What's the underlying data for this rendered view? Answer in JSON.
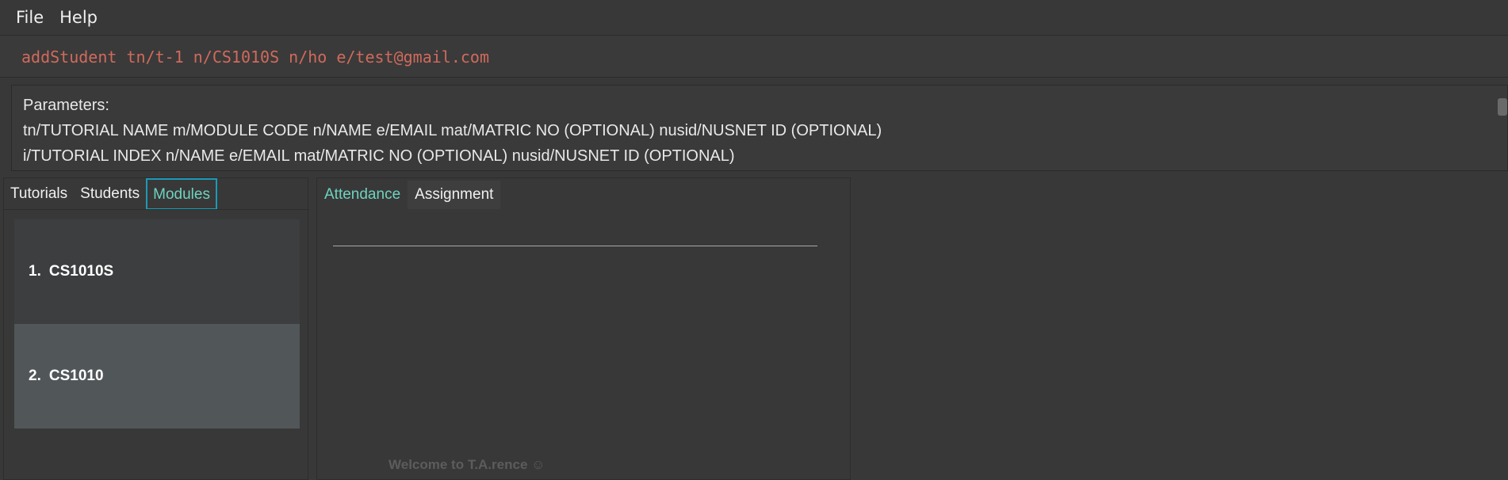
{
  "menu": {
    "items": [
      "File",
      "Help"
    ]
  },
  "command": {
    "value": "addStudent tn/t-1 n/CS1010S n/ho e/test@gmail.com"
  },
  "result": {
    "lines": [
      "Parameters:",
      "tn/TUTORIAL NAME m/MODULE CODE n/NAME e/EMAIL mat/MATRIC NO (OPTIONAL) nusid/NUSNET ID (OPTIONAL)",
      "i/TUTORIAL INDEX n/NAME e/EMAIL mat/MATRIC NO (OPTIONAL) nusid/NUSNET ID (OPTIONAL)"
    ]
  },
  "left_tabs": {
    "items": [
      "Tutorials",
      "Students",
      "Modules"
    ],
    "active": "Modules"
  },
  "modules": [
    {
      "index": "1.",
      "code": "CS1010S"
    },
    {
      "index": "2.",
      "code": "CS1010"
    }
  ],
  "mid_tabs": {
    "items": [
      "Attendance",
      "Assignment"
    ],
    "active": "Attendance"
  },
  "welcome": {
    "text": "Welcome to T.A.rence ☺"
  },
  "colors": {
    "accent": "#6fd2bf",
    "command_text": "#d06a5c",
    "active_tab_border": "#1a9bb8"
  }
}
